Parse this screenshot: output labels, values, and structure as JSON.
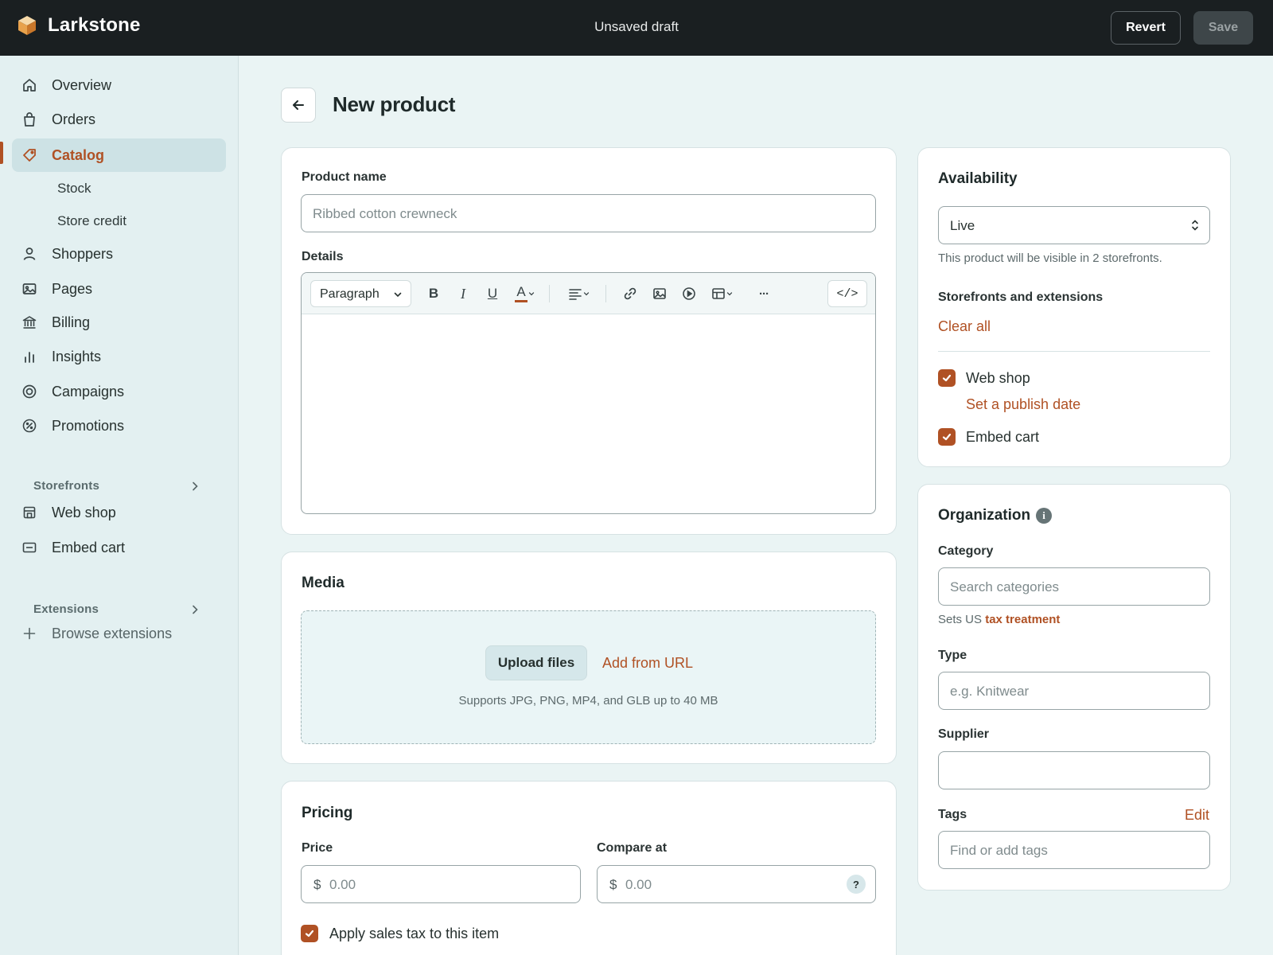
{
  "app": {
    "name": "Larkstone",
    "status": "Unsaved draft",
    "revert_label": "Revert",
    "save_label": "Save"
  },
  "sidebar": {
    "items": [
      {
        "label": "Overview",
        "icon": "home-icon"
      },
      {
        "label": "Orders",
        "icon": "shopping-bag-icon"
      },
      {
        "label": "Catalog",
        "icon": "tag-icon",
        "active": true
      },
      {
        "label": "Shoppers",
        "icon": "person-icon"
      },
      {
        "label": "Pages",
        "icon": "image-icon"
      },
      {
        "label": "Billing",
        "icon": "bank-icon"
      },
      {
        "label": "Insights",
        "icon": "bar-chart-icon"
      },
      {
        "label": "Campaigns",
        "icon": "target-icon"
      },
      {
        "label": "Promotions",
        "icon": "percent-badge-icon"
      }
    ],
    "catalog_sub": [
      "Stock",
      "Store credit"
    ],
    "storefronts_heading": "Storefronts",
    "storefronts": [
      {
        "label": "Web shop",
        "icon": "store-icon"
      },
      {
        "label": "Embed cart",
        "icon": "embed-card-icon"
      }
    ],
    "extensions_heading": "Extensions",
    "browse_extensions": "Browse extensions"
  },
  "page": {
    "title": "New product"
  },
  "product": {
    "name_label": "Product name",
    "name_placeholder": "Ribbed cotton crewneck",
    "details_label": "Details",
    "editor": {
      "paragraph_label": "Paragraph",
      "bold": "B",
      "italic": "I",
      "underline": "U",
      "text_color": "A",
      "more": "···",
      "code": "</>"
    }
  },
  "media": {
    "title": "Media",
    "upload_label": "Upload files",
    "url_label": "Add from URL",
    "hint": "Supports JPG, PNG, MP4, and GLB up to 40 MB"
  },
  "pricing": {
    "title": "Pricing",
    "price_label": "Price",
    "compare_label": "Compare at",
    "currency": "$",
    "price_placeholder": "0.00",
    "compare_placeholder": "0.00",
    "help": "?",
    "tax_label": "Apply sales tax to this item",
    "tax_checked": true
  },
  "availability": {
    "title": "Availability",
    "status": "Live",
    "hint": "This product will be visible in 2 storefronts.",
    "storefronts_heading": "Storefronts and extensions",
    "clear_all": "Clear all",
    "web_shop": "Web shop",
    "web_shop_checked": true,
    "publish_date": "Set a publish date",
    "embed_cart": "Embed cart",
    "embed_cart_checked": true
  },
  "organization": {
    "title": "Organization",
    "info": "i",
    "category_label": "Category",
    "category_placeholder": "Search categories",
    "tax_hint_prefix": "Sets US",
    "tax_hint_link": "tax treatment",
    "type_label": "Type",
    "type_placeholder": "e.g. Knitwear",
    "supplier_label": "Supplier",
    "supplier_value": "",
    "tags_label": "Tags",
    "tags_edit": "Edit",
    "tags_placeholder": "Find or add tags"
  },
  "colors": {
    "accent": "#b05124",
    "topbar": "#1a1f21",
    "sidebar": "#e3f0f1",
    "page_bg": "#eaf4f4",
    "active_nav": "#cde2e5"
  }
}
